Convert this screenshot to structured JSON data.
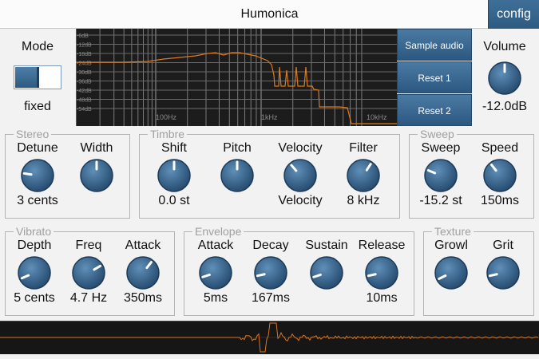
{
  "app": {
    "title": "Humonica",
    "config_label": "config"
  },
  "colors": {
    "accent": "#2e5a80",
    "curve": "#e07a1a",
    "graph_bg": "#1c1c1c"
  },
  "mode": {
    "label": "Mode",
    "value": "fixed"
  },
  "graph": {
    "db_labels": [
      "-6dB",
      "-12dB",
      "-18dB",
      "-24dB",
      "-30dB",
      "-36dB",
      "-42dB",
      "-48dB",
      "-54dB"
    ],
    "freq_labels": [
      "100Hz",
      "1kHz",
      "10kHz"
    ]
  },
  "buttons": {
    "sample_audio": "Sample audio",
    "reset1": "Reset 1",
    "reset2": "Reset 2"
  },
  "volume": {
    "label": "Volume",
    "value": "-12.0dB",
    "level": 0.5
  },
  "groups": {
    "stereo": {
      "title": "Stereo",
      "knobs": [
        {
          "label": "Detune",
          "value": "3 cents",
          "level": 0.2
        },
        {
          "label": "Width",
          "value": "",
          "level": 0.5
        }
      ]
    },
    "timbre": {
      "title": "Timbre",
      "knobs": [
        {
          "label": "Shift",
          "value": "0.0 st",
          "level": 0.5
        },
        {
          "label": "Pitch",
          "value": "",
          "level": 0.5
        },
        {
          "label": "Velocity",
          "value": "Velocity",
          "level": 0.35
        },
        {
          "label": "Filter",
          "value": "8 kHz",
          "level": 0.62
        }
      ]
    },
    "sweep": {
      "title": "Sweep",
      "knobs": [
        {
          "label": "Sweep",
          "value": "-15.2 st",
          "level": 0.25
        },
        {
          "label": "Speed",
          "value": "150ms",
          "level": 0.36
        }
      ]
    },
    "vibrato": {
      "title": "Vibrato",
      "knobs": [
        {
          "label": "Depth",
          "value": "5 cents",
          "level": 0.08
        },
        {
          "label": "Freq",
          "value": "4.7 Hz",
          "level": 0.72
        },
        {
          "label": "Attack",
          "value": "350ms",
          "level": 0.64
        }
      ]
    },
    "envelope": {
      "title": "Envelope",
      "knobs": [
        {
          "label": "Attack",
          "value": "5ms",
          "level": 0.1
        },
        {
          "label": "Decay",
          "value": "167ms",
          "level": 0.12
        },
        {
          "label": "Sustain",
          "value": "",
          "level": 0.1
        },
        {
          "label": "Release",
          "value": "10ms",
          "level": 0.12
        }
      ]
    },
    "texture": {
      "title": "Texture",
      "knobs": [
        {
          "label": "Growl",
          "value": "",
          "level": 0.07
        },
        {
          "label": "Grit",
          "value": "",
          "level": 0.12
        }
      ]
    }
  }
}
